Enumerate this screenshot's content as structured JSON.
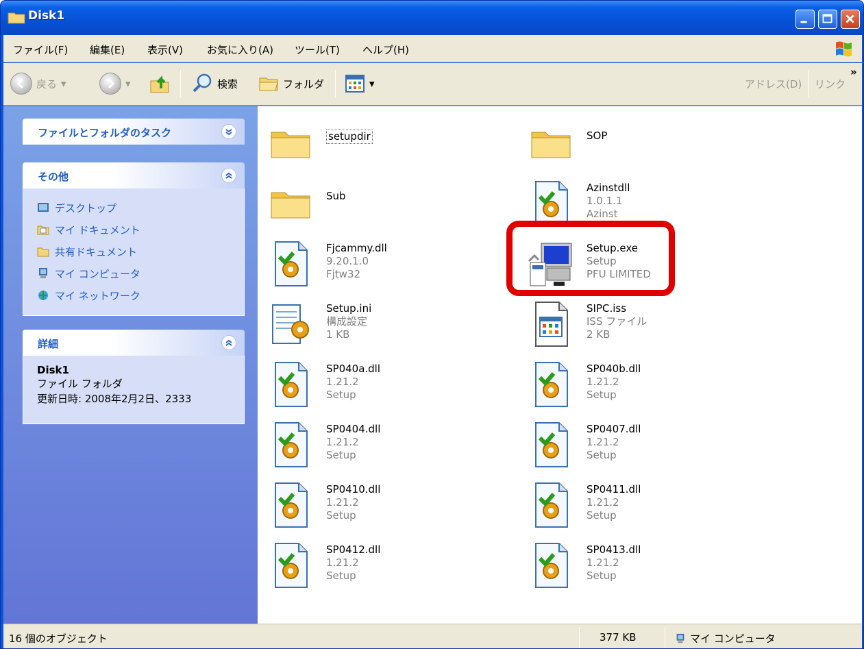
{
  "window": {
    "title": "Disk1"
  },
  "menu": {
    "items": [
      "ファイル(F)",
      "編集(E)",
      "表示(V)",
      "お気に入り(A)",
      "ツール(T)",
      "ヘルプ(H)"
    ]
  },
  "toolbar": {
    "back": "戻る",
    "search": "検索",
    "folders": "フォルダ",
    "address": "アドレス(D)",
    "links": "リンク",
    "chevron": "»"
  },
  "tasks": {
    "file_tasks_title": "ファイルとフォルダのタスク",
    "other_title": "その他",
    "other_links": [
      "デスクトップ",
      "マイ ドキュメント",
      "共有ドキュメント",
      "マイ コンピュータ",
      "マイ ネットワーク"
    ],
    "details_title": "詳細",
    "details_name": "Disk1",
    "details_type": "ファイル フォルダ",
    "details_modified": "更新日時: 2008年2月2日、2333"
  },
  "files": [
    {
      "name": "setupdir",
      "line2": "",
      "line3": "",
      "icon": "folder-icon"
    },
    {
      "name": "SOP",
      "line2": "",
      "line3": "",
      "icon": "folder-icon"
    },
    {
      "name": "Sub",
      "line2": "",
      "line3": "",
      "icon": "folder-icon"
    },
    {
      "name": "Azinstdll",
      "line2": "1.0.1.1",
      "line3": "Azinst",
      "icon": "dll-icon"
    },
    {
      "name": "Fjcammy.dll",
      "line2": "9.20.1.0",
      "line3": "Fjtw32",
      "icon": "dll-icon"
    },
    {
      "name": "Setup.exe",
      "line2": "Setup",
      "line3": "PFU LIMITED",
      "icon": "setup-exe-icon"
    },
    {
      "name": "Setup.ini",
      "line2": "構成設定",
      "line3": "1 KB",
      "icon": "ini-icon"
    },
    {
      "name": "SIPC.iss",
      "line2": "ISS ファイル",
      "line3": "2 KB",
      "icon": "iss-icon"
    },
    {
      "name": "SP040a.dll",
      "line2": "1.21.2",
      "line3": "Setup",
      "icon": "dll-icon"
    },
    {
      "name": "SP040b.dll",
      "line2": "1.21.2",
      "line3": "Setup",
      "icon": "dll-icon"
    },
    {
      "name": "SP0404.dll",
      "line2": "1.21.2",
      "line3": "Setup",
      "icon": "dll-icon"
    },
    {
      "name": "SP0407.dll",
      "line2": "1.21.2",
      "line3": "Setup",
      "icon": "dll-icon"
    },
    {
      "name": "SP0410.dll",
      "line2": "1.21.2",
      "line3": "Setup",
      "icon": "dll-icon"
    },
    {
      "name": "SP0411.dll",
      "line2": "1.21.2",
      "line3": "Setup",
      "icon": "dll-icon"
    },
    {
      "name": "SP0412.dll",
      "line2": "1.21.2",
      "line3": "Setup",
      "icon": "dll-icon"
    },
    {
      "name": "SP0413.dll",
      "line2": "1.21.2",
      "line3": "Setup",
      "icon": "dll-icon"
    }
  ],
  "status": {
    "count": "16 個のオブジェクト",
    "size": "377 KB",
    "location": "マイ コンピュータ"
  },
  "colors": {
    "highlight": "#e00000",
    "task_link": "#215dc6",
    "title_bar": "#0a5fe6"
  }
}
